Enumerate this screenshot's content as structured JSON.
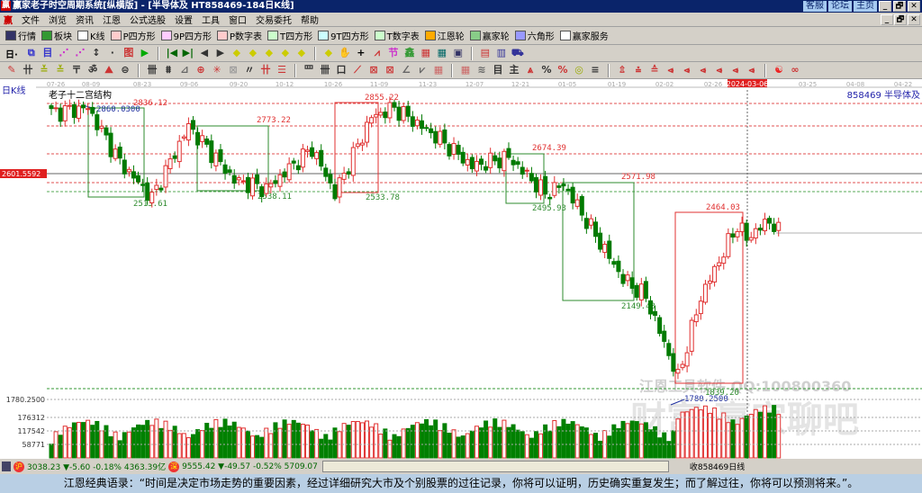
{
  "window": {
    "title": "赢家老子时空周期系统[纵横版] - [半导体及   HT858469-184日K线]",
    "logo": "赢",
    "links": [
      "客服",
      "论坛",
      "主页"
    ],
    "controls": [
      "_",
      "🗗",
      "✕"
    ]
  },
  "menu": {
    "logo": "赢",
    "items": [
      "文件",
      "浏览",
      "资讯",
      "江恩",
      "公式选股",
      "设置",
      "工具",
      "窗口",
      "交易委托",
      "帮助"
    ]
  },
  "toolbar1": [
    {
      "icon": "quotes-icon",
      "label": "行情"
    },
    {
      "icon": "blocks-icon",
      "label": "板块"
    },
    {
      "icon": "kline-icon",
      "label": "K线"
    },
    {
      "icon": "P4",
      "label": "P四方形"
    },
    {
      "icon": "P9",
      "label": "9P四方形"
    },
    {
      "icon": "PN",
      "label": "P数字表"
    },
    {
      "icon": "T4",
      "label": "T四方形"
    },
    {
      "icon": "T9",
      "label": "9T四方形"
    },
    {
      "icon": "TN",
      "label": "T数字表"
    },
    {
      "icon": "gann-wheel-icon",
      "label": "江恩轮"
    },
    {
      "icon": "winner-wheel-icon",
      "label": "赢家轮"
    },
    {
      "icon": "hexagon-icon",
      "label": "六角形"
    },
    {
      "icon": "dollar-icon",
      "label": "赢家服务"
    }
  ],
  "toolbar2": {
    "period": "日·",
    "glyphs": [
      "⧉",
      "目",
      "⋰",
      "⋰",
      "↕",
      "·",
      "图",
      "▶",
      "|◀",
      "▶|",
      "◀",
      "▶",
      "◆",
      "◆",
      "◆",
      "◆",
      "◆",
      "◆",
      "✋",
      "+",
      "⩘",
      "节",
      "鑫",
      "▦",
      "▦",
      "▣",
      "▤",
      "▥",
      "⛟"
    ]
  },
  "toolbar3": {
    "glyphs": [
      "✎",
      "卄",
      "≚",
      "≚",
      "〒",
      "ॐ",
      "⛰",
      "⊜",
      "卌",
      "⩩",
      "⊿",
      "⊕",
      "✳",
      "⊠",
      "〃",
      "卄",
      "☰",
      "罒",
      "卌",
      "口",
      "⟋",
      "⊠",
      "⊠",
      "∠",
      "⩗",
      "▦",
      "▦",
      "≋",
      "目",
      "主",
      "⩓",
      "%",
      "%",
      "◎",
      "≡",
      "⇭",
      "⩮",
      "≙",
      "⩹",
      "⩹",
      "⩹",
      "⩹",
      "⩹",
      "⩹",
      "☯",
      "∞"
    ]
  },
  "chart": {
    "period_label": "日K线",
    "security": "858469 半导体及",
    "structure_label": "老子十二宫结构",
    "cursor_date": "2024-03-06",
    "cursor_price_label": "2601.5592",
    "dates": [
      "07-26",
      "08-09",
      "08-23",
      "09-06",
      "09-20",
      "10-12",
      "10-26",
      "11-09",
      "11-23",
      "12-07",
      "12-21",
      "01-05",
      "01-19",
      "02-02",
      "02-26",
      "2024-03-06",
      "03-25",
      "04-08",
      "04-22"
    ],
    "watermark1": "江恩工具软件  QQ:100800360",
    "watermark2": "财富 赢家聊吧",
    "colors": {
      "up": "#e03030",
      "down": "#008000",
      "resistance": "#e03030",
      "support": "#2e8b2e",
      "annotation": "#2030a0"
    }
  },
  "chart_data": {
    "type": "candlestick",
    "ylim": [
      1780.25,
      2860.03
    ],
    "price_levels_resistance": [
      2836.12,
      2773.22,
      2674.39,
      2571.98,
      2464.03,
      2855.22
    ],
    "price_levels_support": [
      2513.61,
      2538.11,
      2533.78,
      2495.93,
      2149.43,
      1839.2
    ],
    "labels": [
      "2836.12",
      "2773.22",
      "2855.22",
      "2674.39",
      "2571.98",
      "2464.03",
      "2513.61",
      "2538.11",
      "2533.78",
      "2495.93",
      "2149.43",
      "1839.20",
      "2860.0300",
      "1780.2500"
    ],
    "close_keypoints": [
      [
        0,
        2804
      ],
      [
        8,
        2820
      ],
      [
        15,
        2627
      ],
      [
        22,
        2499
      ],
      [
        25,
        2595
      ],
      [
        30,
        2756
      ],
      [
        40,
        2563
      ],
      [
        47,
        2531
      ],
      [
        57,
        2676
      ],
      [
        62,
        2515
      ],
      [
        70,
        2788
      ],
      [
        75,
        2820
      ],
      [
        85,
        2708
      ],
      [
        92,
        2612
      ],
      [
        100,
        2644
      ],
      [
        108,
        2515
      ],
      [
        112,
        2547
      ],
      [
        125,
        2210
      ],
      [
        130,
        2146
      ],
      [
        137,
        1857
      ],
      [
        142,
        2146
      ],
      [
        150,
        2403
      ],
      [
        152,
        2355
      ],
      [
        157,
        2419
      ],
      [
        159,
        2377
      ]
    ],
    "volume_ticks": [
      "1780.2500",
      "176312",
      "117542",
      "58771"
    ],
    "volume_tick_values": [
      176312,
      117542,
      58771
    ]
  },
  "status": {
    "sh_icon": "沪",
    "sh": "3038.23 ▼-5.60 -0.18% 4363.39亿",
    "sz_icon": "深",
    "sz": "9555.42 ▼-49.57 -0.52% 5709.07",
    "right": "收858469日线"
  },
  "quote": "江恩经典语录：“时间是决定市场走势的重要因素，经过详细研究大市及个别股票的过往记录，你将可以证明，历史确实重复发生；而了解过往，你将可以预测将来。”。"
}
